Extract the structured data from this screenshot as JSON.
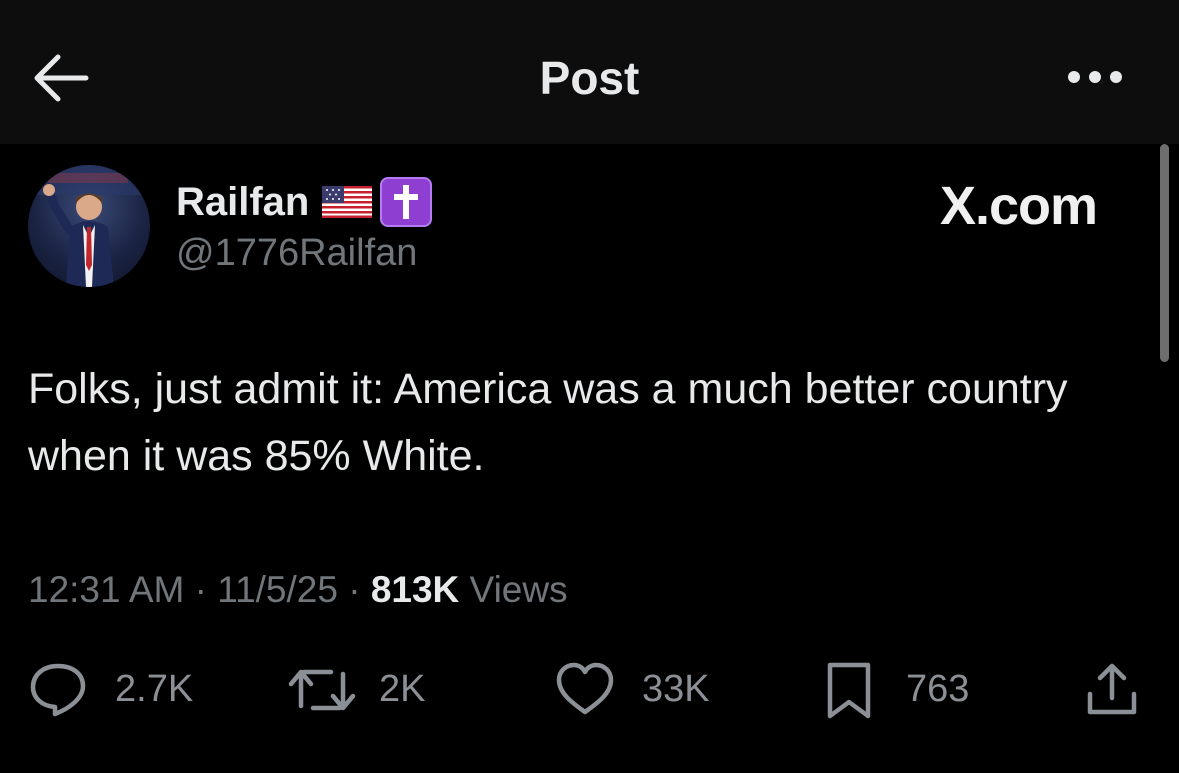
{
  "header": {
    "title": "Post",
    "back_icon": "arrow-left-icon",
    "more_icon": "more-horizontal-icon"
  },
  "author": {
    "display_name": "Railfan",
    "handle": "@1776Railfan",
    "badges": [
      "us-flag-icon",
      "latin-cross-icon"
    ]
  },
  "watermark": "X.com",
  "tweet": {
    "text": "Folks, just admit it: America was a much better country when it was 85% White."
  },
  "meta": {
    "time": "12:31 AM",
    "sep1": " · ",
    "date": "11/5/25",
    "sep2": " · ",
    "views_count": "813K",
    "views_label": " Views"
  },
  "actions": {
    "replies": "2.7K",
    "reposts": "2K",
    "likes": "33K",
    "bookmarks": "763"
  },
  "colors": {
    "background": "#000000",
    "header_bg": "#0d0d0d",
    "primary_text": "#e7e9ea",
    "secondary_text": "#71767b",
    "cross_badge": "#8e3fd2"
  }
}
